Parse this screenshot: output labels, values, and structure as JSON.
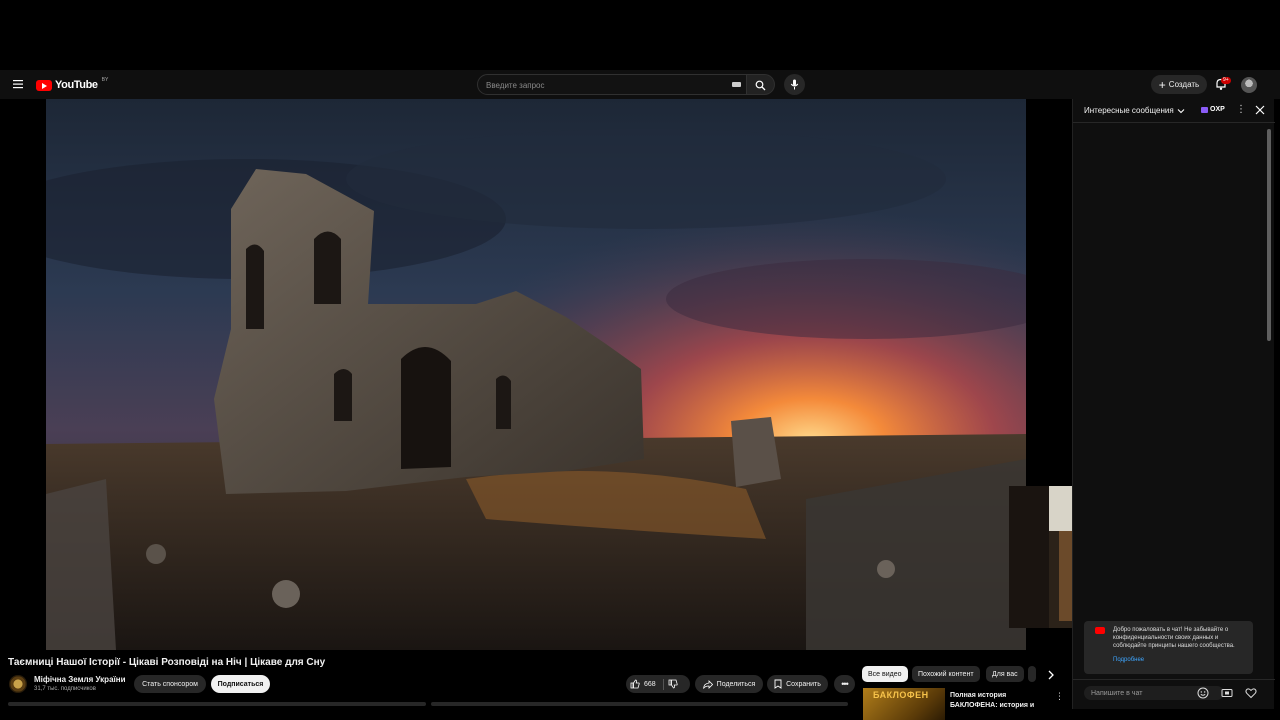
{
  "header": {
    "logo_text": "YouTube",
    "region_badge": "BY",
    "search_placeholder": "Введите запрос",
    "create_label": "Создать",
    "notification_count": "9+"
  },
  "video": {
    "title": "Таємниці Нашої Історії - Цікаві Розповіді на Ніч | Цікаве для Сну",
    "thumbnail_subject": "ruined stone church at sunset"
  },
  "channel": {
    "name": "Міфічна Земля України",
    "subscribers": "31,7 тыс. подписчиков",
    "sponsor_label": "Стать спонсором",
    "subscribe_label": "Подписаться"
  },
  "actions": {
    "likes": "668",
    "share_label": "Поделиться",
    "save_label": "Сохранить"
  },
  "chips": [
    "Все видео",
    "Похожий контент",
    "Для вас"
  ],
  "recommendation": {
    "thumb_text": "БАКЛОФЕН",
    "title": "Полная история БАКЛОФЕНА: история и эффекты. От"
  },
  "chat": {
    "title": "Интересные сообщения",
    "badge": "OXP",
    "welcome_text": "Добро пожаловать в чат! Не забывайте о конфиденциальности своих данных и соблюдайте принципы нашего сообщества.",
    "welcome_link": "Подробнее",
    "input_placeholder": "Напишите в чат"
  },
  "colors": {
    "brand_red": "#ff0000",
    "background": "#0f0f0f",
    "chip_bg": "#272727",
    "link_blue": "#3ea6ff"
  }
}
